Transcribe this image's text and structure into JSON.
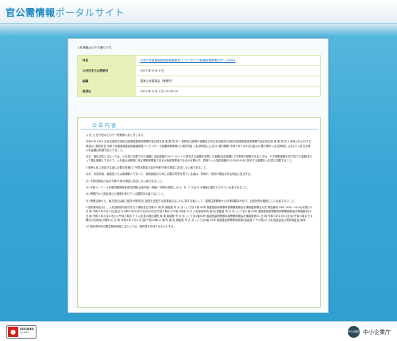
{
  "header": {
    "title": "官公需情報",
    "subtitle": "ポータルサイト"
  },
  "intro": "入札情報は以下の通りです。",
  "info_rows": [
    {
      "label": "件名",
      "value": "令和５年度奥能登豪雨被害緊急バックフローズ設備修理事業",
      "link": true,
      "suffix": "[PDF：99KB]"
    },
    {
      "label": "公示日または更新日",
      "value": "2023 年 8 月 4 日",
      "link": false,
      "suffix": ""
    },
    {
      "label": "組織",
      "value": "国家公安委員会（警察庁）",
      "link": false,
      "suffix": ""
    },
    {
      "label": "取得日",
      "value": "2023 年 8 月 4 日 19:05:29",
      "link": false,
      "suffix": ""
    }
  ],
  "notice": {
    "title": "公告内容",
    "paragraphs": [
      "入 札 公 告下記のとおり一般競争入札に付します。",
      "令和５年８月４日支出負担行為担当官奥能登豪雨警察庁会計担当官 奥 藤 知 史 1 契約担当官等の官職及び氏名支出負担行為担当官奥能登豪雨警察庁会計担当官 奥 藤 知 史 2 競争入札に付する事項(1) 契約件名 令和５年度奥能登豪雨被害緊急バックフローズ設備修理事業(2) 契約内容 入札説明書による(3) 履行期限 令和６年３月29日(金)(4) 履行場所 入札説明書による(5) 入札方法等 入札金額は総価を記入すること。",
      "なお、落札決定に当たっては、入札書に記載された金額に当該金額の10パーセントに相当する金額を加算した金額(当該金額に1円未満の端数があるときは、その端数金額を切り捨てた金額)をもって落札価格とするので、入札者は消費税に係る課税事業者であるか免税事業者であるかを問わず、見積もった契約金額の110分の100に相当する金額を入札書に記載すること。",
      "3 競争入札に参加する者に必要な資格(1) 予算決算及び会計令第70条の規定に該当しない者であること。",
      "なお、未成年者、被保佐人又は被補助人であって、契約締結のために必要な同意を得ている者は、同条中、特別の理由がある場合に該当する。",
      "(2) 予算決算及び会計令第71条の規定に該当しない者であること。",
      "(3) 令和４・５・６年度内閣府競争参加資格(全省庁統一資格)「役務の提供」の A、B、C 又は D の等級に格付けされている者であること。",
      "(4) 警察庁から指名停止の措置を受けている期間中の者でないこと。",
      "(5) 警察当局から、暴力団又は暴力団員が実質的に経営を支配する事業者又はこれに準ずる者として、国発注業務等からの排除要請があり、当該状態が継続している者でないこと。",
      "4 契約条項を示し、入札説明書の配付を行う場所及び日時(1) 場 所 奥能登 市 大 字 ○○丁目 1番 50号 奥能登豪雨警察本部警察総務会計課用度係問合せ先 電話番号 088－826－0110(代表)(2) 日 時 令和５年８月４日(金)から令和５年８月22日(月)(平日)午前９時から午後５時まで(3) 入札参加申請 奥 地 奥能登 市 大 字 ○○丁目1 番 50号 奥能登豪雨警察本部警察総務会計課用度係(4) 日 時 令和５年８月23日(火)午後５時まで 5 入札書の提出場所 奥 地 奥能登 市 大 字 ○○丁目1番50号 奥能登豪雨警察本部警察総務会計課用度係(5) 日 時 令和５年８月31日(木)午後５時まで 6 開札の日時及び場所(1) 日 時 令和５年９月１日(金)午前10時(2) 場 所 奥 地 奥能登 市 大 字 ○○丁目1番 50号 奥能登豪雨警察本部第1会議室 7 その他(1) 入札保証金及び契約保証金 免除",
      "10 契約書作成の要否契約締結に当たっては、契約書を作成するものとする。"
    ]
  },
  "footer": {
    "seal_line1": "SECURED",
    "seal_line2": "by JPRS",
    "brand_logo": "中小企業庁",
    "brand_name": "中小企業庁"
  },
  "colors": {
    "accent": "#1c86c3",
    "background_blue": "#3aa7d6",
    "table_header": "#e9f0b8",
    "seal_red": "#d42020"
  },
  "icons": [
    "lock-icon",
    "brand-logo-icon"
  ]
}
